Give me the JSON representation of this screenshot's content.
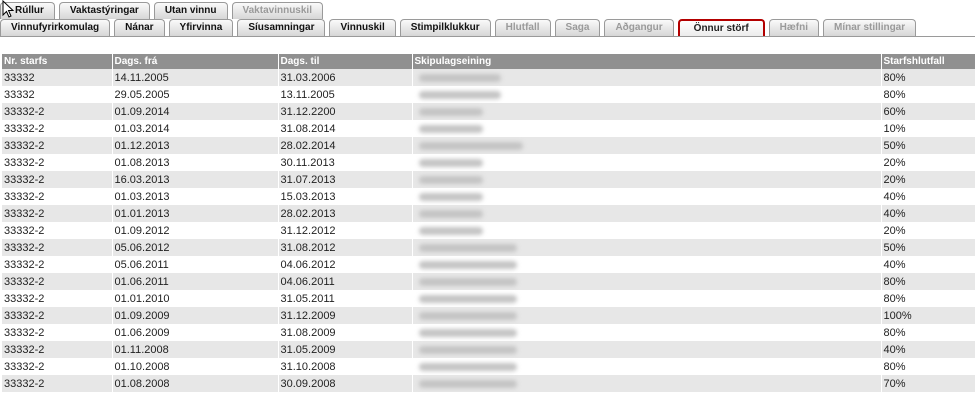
{
  "tabs_row1": [
    {
      "label": "Rúllur",
      "dim": false
    },
    {
      "label": "Vaktastýringar",
      "dim": false
    },
    {
      "label": "Utan vinnu",
      "dim": false
    },
    {
      "label": "Vaktavinnuskil",
      "dim": true
    }
  ],
  "tabs_row2": [
    {
      "label": "Vinnufyrirkomulag",
      "dim": false,
      "active": false
    },
    {
      "label": "Nánar",
      "dim": false,
      "active": false
    },
    {
      "label": "Yfirvinna",
      "dim": false,
      "active": false
    },
    {
      "label": "Síusamningar",
      "dim": false,
      "active": false
    },
    {
      "label": "Vinnuskil",
      "dim": false,
      "active": false
    },
    {
      "label": "Stimpilklukkur",
      "dim": false,
      "active": false
    },
    {
      "label": "Hlutfall",
      "dim": true,
      "active": false
    },
    {
      "label": "Saga",
      "dim": true,
      "active": false
    },
    {
      "label": "Aðgangur",
      "dim": true,
      "active": false
    },
    {
      "label": "Önnur störf",
      "dim": false,
      "active": true
    },
    {
      "label": "Hæfni",
      "dim": true,
      "active": false
    },
    {
      "label": "Mínar stillingar",
      "dim": true,
      "active": false
    }
  ],
  "table": {
    "headers": [
      "Nr. starfs",
      "Dags. frá",
      "Dags. til",
      "Skipulagseining",
      "Starfshlutfall"
    ],
    "rows": [
      [
        "33332",
        "14.11.2005",
        "31.03.2006",
        "80%"
      ],
      [
        "33332",
        "29.05.2005",
        "13.11.2005",
        "80%"
      ],
      [
        "33332-2",
        "01.09.2014",
        "31.12.2200",
        "60%"
      ],
      [
        "33332-2",
        "01.03.2014",
        "31.08.2014",
        "10%"
      ],
      [
        "33332-2",
        "01.12.2013",
        "28.02.2014",
        "50%"
      ],
      [
        "33332-2",
        "01.08.2013",
        "30.11.2013",
        "20%"
      ],
      [
        "33332-2",
        "16.03.2013",
        "31.07.2013",
        "20%"
      ],
      [
        "33332-2",
        "01.03.2013",
        "15.03.2013",
        "40%"
      ],
      [
        "33332-2",
        "01.01.2013",
        "28.02.2013",
        "40%"
      ],
      [
        "33332-2",
        "01.09.2012",
        "31.12.2012",
        "20%"
      ],
      [
        "33332-2",
        "05.06.2012",
        "31.08.2012",
        "50%"
      ],
      [
        "33332-2",
        "05.06.2011",
        "04.06.2012",
        "40%"
      ],
      [
        "33332-2",
        "01.06.2011",
        "04.06.2011",
        "80%"
      ],
      [
        "33332-2",
        "01.01.2010",
        "31.05.2011",
        "80%"
      ],
      [
        "33332-2",
        "01.09.2009",
        "31.12.2009",
        "100%"
      ],
      [
        "33332-2",
        "01.06.2009",
        "31.08.2009",
        "80%"
      ],
      [
        "33332-2",
        "01.11.2008",
        "31.05.2009",
        "40%"
      ],
      [
        "33332-2",
        "01.10.2008",
        "31.10.2008",
        "80%"
      ],
      [
        "33332-2",
        "01.08.2008",
        "30.09.2008",
        "70%"
      ]
    ]
  },
  "colors": {
    "header_bg": "#909090",
    "row_alt_bg": "#e7e7e7",
    "active_tab_border": "#b30000"
  },
  "icons": {
    "cursor": "mouse-pointer-icon"
  }
}
